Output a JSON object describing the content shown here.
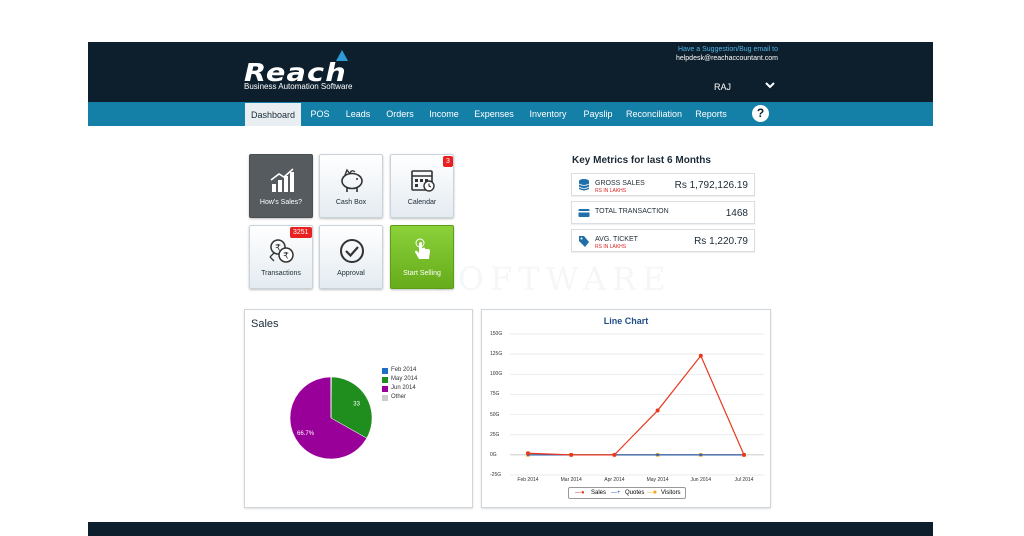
{
  "header": {
    "logo_text": "Reach",
    "logo_subtitle": "Business Automation Software",
    "suggestion_text": "Have a Suggestion/Bug email to",
    "support_email": "helpdesk@reachaccountant.com",
    "user_name": "RAJ"
  },
  "nav": {
    "items": [
      "Dashboard",
      "POS",
      "Leads",
      "Orders",
      "Income",
      "Expenses",
      "Inventory",
      "Payslip",
      "Reconciliation",
      "Reports"
    ],
    "active": "Dashboard",
    "help_label": "?"
  },
  "tiles": [
    {
      "label": "How's Sales?",
      "icon": "bar-chart-icon"
    },
    {
      "label": "Cash Box",
      "icon": "piggy-bank-icon"
    },
    {
      "label": "Calendar",
      "icon": "calendar-icon",
      "badge": "3"
    },
    {
      "label": "Transactions",
      "icon": "rupee-exchange-icon",
      "badge": "3251"
    },
    {
      "label": "Approval",
      "icon": "check-circle-icon"
    },
    {
      "label": "Start Selling",
      "icon": "hand-pointer-icon"
    }
  ],
  "metrics": {
    "title": "Key Metrics for last 6 Months",
    "rows": [
      {
        "label": "GROSS SALES",
        "sub": "RS IN LAKHS",
        "value": "Rs 1,792,126.19",
        "icon": "coins-icon"
      },
      {
        "label": "TOTAL TRANSACTION",
        "sub": "",
        "value": "1468",
        "icon": "card-icon"
      },
      {
        "label": "AVG. TICKET",
        "sub": "RS IN LAKHS",
        "value": "Rs 1,220.79",
        "icon": "tag-icon"
      }
    ]
  },
  "colors": {
    "header_bg": "#0d1f2d",
    "nav_bg": "#1480a8",
    "accent_green": "#7cc02a",
    "badge_red": "#e82020"
  },
  "chart_data": [
    {
      "type": "pie",
      "title": "Sales",
      "legend": [
        "Feb 2014",
        "May 2014",
        "Jun 2014",
        "Other"
      ],
      "legend_colors": [
        "#1f6fc5",
        "#1f8e1f",
        "#990099",
        "#cccccc"
      ],
      "values": [
        0.2,
        33,
        66.7,
        0.1
      ],
      "slice_labels": [
        "",
        "33",
        "66.7%",
        ""
      ]
    },
    {
      "type": "line",
      "title": "Line Chart",
      "categories": [
        "Feb 2014",
        "Mar 2014",
        "Apr 2014",
        "May 2014",
        "Jun 2014",
        "Jul 2014"
      ],
      "y_ticks": [
        "150G",
        "125G",
        "100G",
        "75G",
        "50G",
        "25G",
        "0G",
        "-25G"
      ],
      "ylim": [
        -25,
        150
      ],
      "series": [
        {
          "name": "Sales",
          "color": "#e8391f",
          "values": [
            2,
            0,
            0,
            55,
            123,
            0
          ]
        },
        {
          "name": "Quotes",
          "color": "#2a5db0",
          "values": [
            0,
            0,
            0,
            0,
            0,
            0
          ]
        },
        {
          "name": "Visitors",
          "color": "#f5a623",
          "values": [
            0,
            0,
            0,
            0,
            0,
            0
          ]
        }
      ]
    }
  ]
}
